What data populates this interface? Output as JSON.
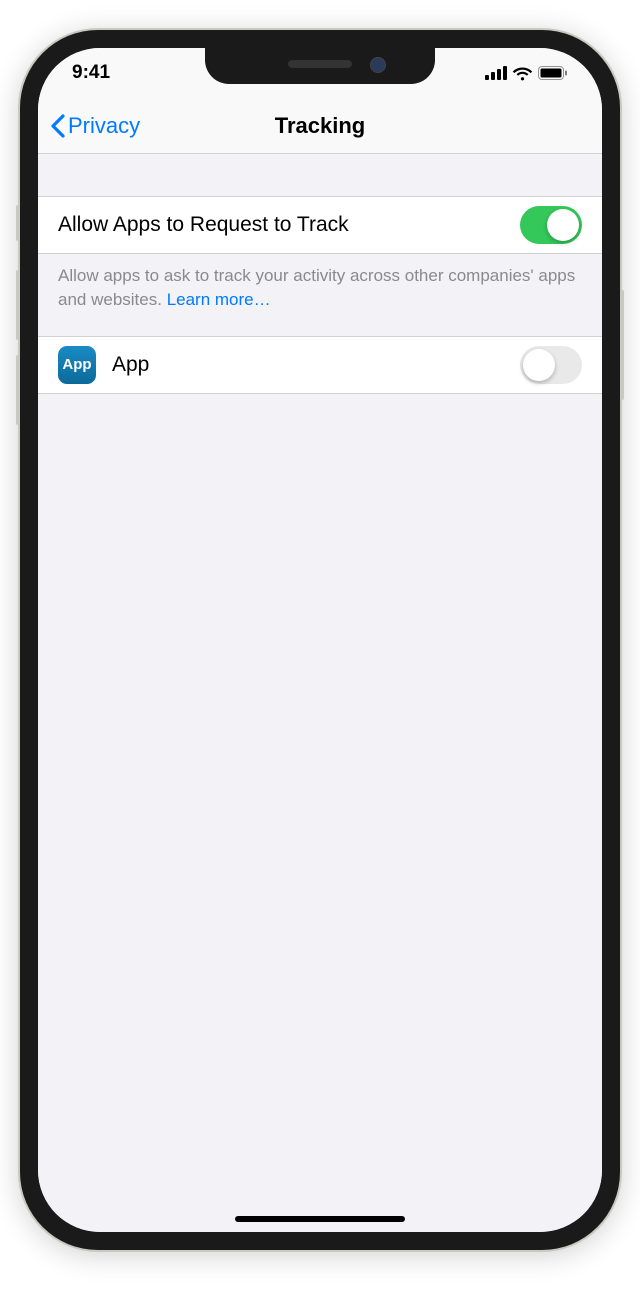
{
  "status": {
    "time": "9:41"
  },
  "nav": {
    "back_label": "Privacy",
    "title": "Tracking"
  },
  "settings": {
    "allow_request_label": "Allow Apps to Request to Track",
    "allow_request_on": true,
    "description": "Allow apps to ask to track your activity across other companies' apps and websites. ",
    "learn_more": "Learn more…"
  },
  "apps": [
    {
      "icon_text": "App",
      "name": "App",
      "tracking_on": false
    }
  ]
}
